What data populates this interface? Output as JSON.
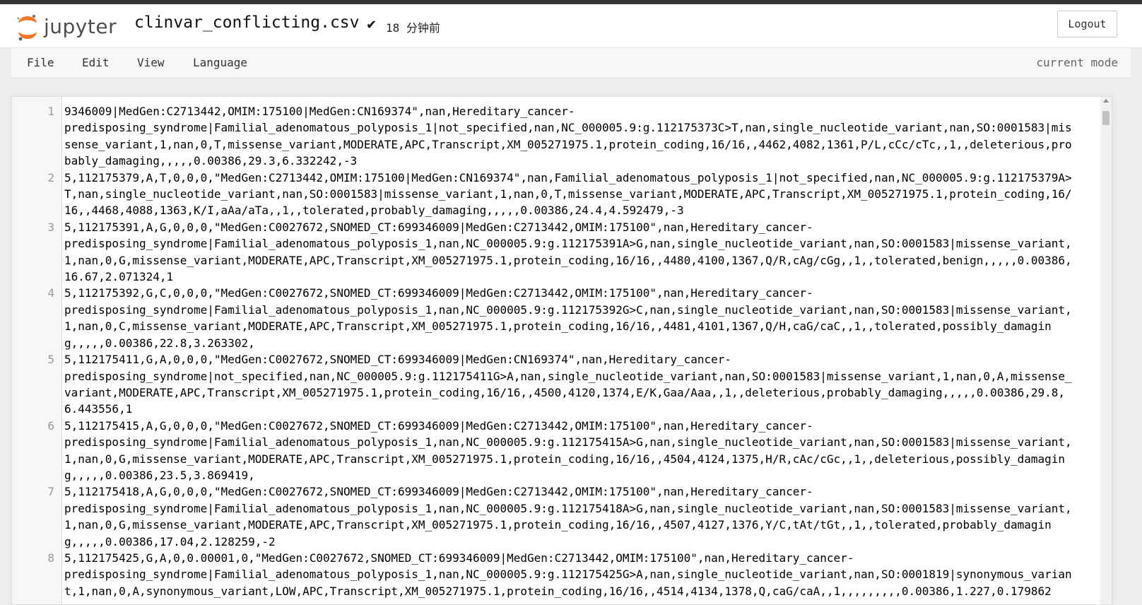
{
  "app": {
    "logo_text": "jupyter",
    "filename": "clinvar_conflicting.csv",
    "saved_status": "18 分钟前",
    "logout_label": "Logout"
  },
  "menu": {
    "items": [
      {
        "label": "File"
      },
      {
        "label": "Edit"
      },
      {
        "label": "View"
      },
      {
        "label": "Language"
      }
    ],
    "mode": "current mode"
  },
  "editor": {
    "lines": [
      {
        "number": "1",
        "text": "9346009|MedGen:C2713442,OMIM:175100|MedGen:CN169374\",nan,Hereditary_cancer-\npredisposing_syndrome|Familial_adenomatous_polyposis_1|not_specified,nan,NC_000005.9:g.112175373C>T,nan,single_nucleotide_variant,nan,SO:0001583|missense_variant,1,nan,0,T,missense_variant,MODERATE,APC,Transcript,XM_005271975.1,protein_coding,16/16,,4462,4082,1361,P/L,cCc/cTc,,1,,deleterious,probably_damaging,,,,,0.00386,29.3,6.332242,-3"
      },
      {
        "number": "2",
        "text": "5,112175379,A,T,0,0,0,\"MedGen:C2713442,OMIM:175100|MedGen:CN169374\",nan,Familial_adenomatous_polyposis_1|not_specified,nan,NC_000005.9:g.112175379A>T,nan,single_nucleotide_variant,nan,SO:0001583|missense_variant,1,nan,0,T,missense_variant,MODERATE,APC,Transcript,XM_005271975.1,protein_coding,16/16,,4468,4088,1363,K/I,aAa/aTa,,1,,tolerated,probably_damaging,,,,,0.00386,24.4,4.592479,-3"
      },
      {
        "number": "3",
        "text": "5,112175391,A,G,0,0,0,\"MedGen:C0027672,SNOMED_CT:699346009|MedGen:C2713442,OMIM:175100\",nan,Hereditary_cancer-\npredisposing_syndrome|Familial_adenomatous_polyposis_1,nan,NC_000005.9:g.112175391A>G,nan,single_nucleotide_variant,nan,SO:0001583|missense_variant,1,nan,0,G,missense_variant,MODERATE,APC,Transcript,XM_005271975.1,protein_coding,16/16,,4480,4100,1367,Q/R,cAg/cGg,,1,,tolerated,benign,,,,,0.00386,16.67,2.071324,1"
      },
      {
        "number": "4",
        "text": "5,112175392,G,C,0,0,0,\"MedGen:C0027672,SNOMED_CT:699346009|MedGen:C2713442,OMIM:175100\",nan,Hereditary_cancer-\npredisposing_syndrome|Familial_adenomatous_polyposis_1,nan,NC_000005.9:g.112175392G>C,nan,single_nucleotide_variant,nan,SO:0001583|missense_variant,1,nan,0,C,missense_variant,MODERATE,APC,Transcript,XM_005271975.1,protein_coding,16/16,,4481,4101,1367,Q/H,caG/caC,,1,,tolerated,possibly_damaging,,,,,0.00386,22.8,3.263302,"
      },
      {
        "number": "5",
        "text": "5,112175411,G,A,0,0,0,\"MedGen:C0027672,SNOMED_CT:699346009|MedGen:CN169374\",nan,Hereditary_cancer-\npredisposing_syndrome|not_specified,nan,NC_000005.9:g.112175411G>A,nan,single_nucleotide_variant,nan,SO:0001583|missense_variant,1,nan,0,A,missense_variant,MODERATE,APC,Transcript,XM_005271975.1,protein_coding,16/16,,4500,4120,1374,E/K,Gaa/Aaa,,1,,deleterious,probably_damaging,,,,,0.00386,29.8,6.443556,1"
      },
      {
        "number": "6",
        "text": "5,112175415,A,G,0,0,0,\"MedGen:C0027672,SNOMED_CT:699346009|MedGen:C2713442,OMIM:175100\",nan,Hereditary_cancer-\npredisposing_syndrome|Familial_adenomatous_polyposis_1,nan,NC_000005.9:g.112175415A>G,nan,single_nucleotide_variant,nan,SO:0001583|missense_variant,1,nan,0,G,missense_variant,MODERATE,APC,Transcript,XM_005271975.1,protein_coding,16/16,,4504,4124,1375,H/R,cAc/cGc,,1,,deleterious,possibly_damaging,,,,,0.00386,23.5,3.869419,"
      },
      {
        "number": "7",
        "text": "5,112175418,A,G,0,0,0,\"MedGen:C0027672,SNOMED_CT:699346009|MedGen:C2713442,OMIM:175100\",nan,Hereditary_cancer-\npredisposing_syndrome|Familial_adenomatous_polyposis_1,nan,NC_000005.9:g.112175418A>G,nan,single_nucleotide_variant,nan,SO:0001583|missense_variant,1,nan,0,G,missense_variant,MODERATE,APC,Transcript,XM_005271975.1,protein_coding,16/16,,4507,4127,1376,Y/C,tAt/tGt,,1,,tolerated,probably_damaging,,,,,0.00386,17.04,2.128259,-2"
      },
      {
        "number": "8",
        "text": "5,112175425,G,A,0,0.00001,0,\"MedGen:C0027672,SNOMED_CT:699346009|MedGen:C2713442,OMIM:175100\",nan,Hereditary_cancer-\npredisposing_syndrome|Familial_adenomatous_polyposis_1,nan,NC_000005.9:g.112175425G>A,nan,single_nucleotide_variant,nan,SO:0001819|synonymous_variant,1,nan,0,A,synonymous_variant,LOW,APC,Transcript,XM_005271975.1,protein_coding,16/16,,4514,4134,1378,Q,caG/caA,,1,,,,,,,,,0.00386,1.227,0.179862"
      }
    ]
  }
}
